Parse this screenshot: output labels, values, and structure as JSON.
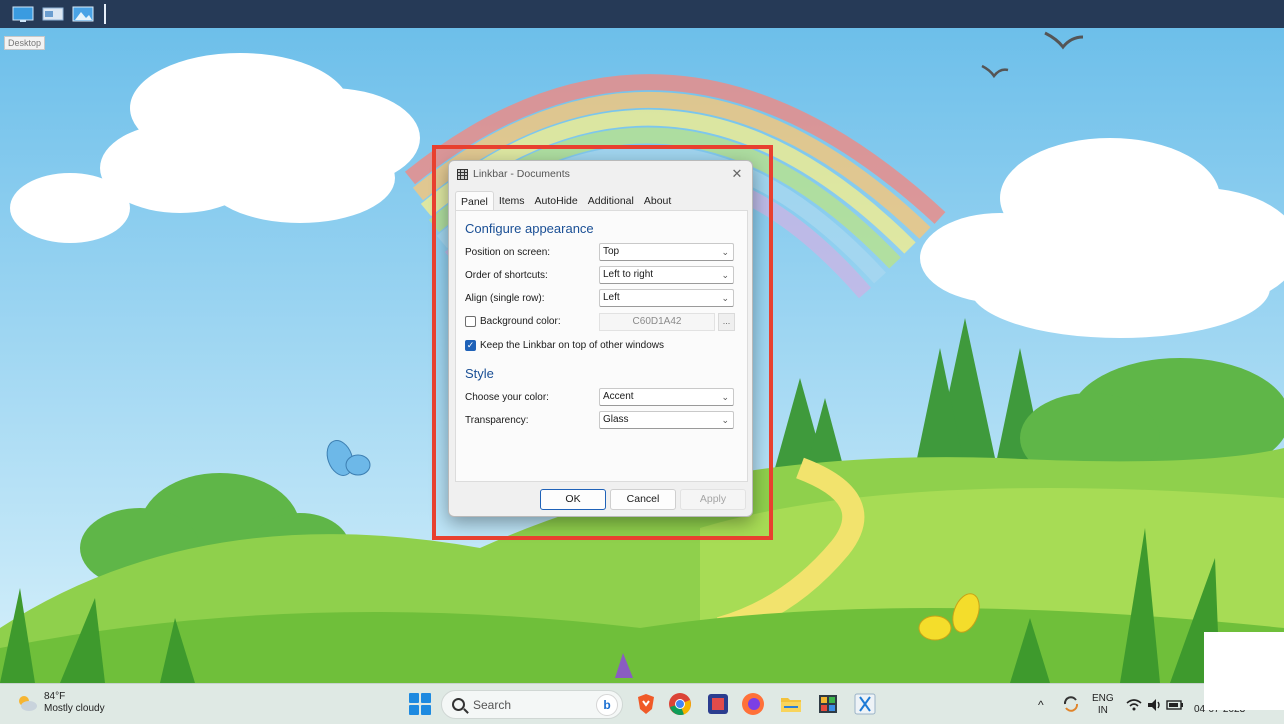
{
  "linkbar": {
    "items": [
      "desktop-icon",
      "explorer-icon",
      "pictures-icon"
    ],
    "tooltip": "Desktop"
  },
  "dialog": {
    "title": "Linkbar - Documents",
    "tabs": [
      "Panel",
      "Items",
      "AutoHide",
      "Additional",
      "About"
    ],
    "active_tab": "Panel",
    "appearance": {
      "heading": "Configure appearance",
      "position_label": "Position on screen:",
      "position_value": "Top",
      "order_label": "Order of shortcuts:",
      "order_value": "Left to right",
      "align_label": "Align (single row):",
      "align_value": "Left",
      "bgcolor_label": "Background color:",
      "bgcolor_checked": false,
      "bgcolor_value": "C60D1A42",
      "bgcolor_button": "...",
      "ontop_label": "Keep the Linkbar on top of other windows",
      "ontop_checked": true
    },
    "style": {
      "heading": "Style",
      "color_label": "Choose your color:",
      "color_value": "Accent",
      "transparency_label": "Transparency:",
      "transparency_value": "Glass"
    },
    "buttons": {
      "ok": "OK",
      "cancel": "Cancel",
      "apply": "Apply"
    },
    "chevron": "⌄",
    "close": "✕",
    "check_mark": "✓"
  },
  "highlight_color": "#e8402f",
  "taskbar": {
    "weather_temp": "84°F",
    "weather_desc": "Mostly cloudy",
    "search_placeholder": "Search",
    "bing_label": "b",
    "apps": [
      "brave-icon",
      "chrome-icon",
      "app-icon",
      "firefox-icon",
      "file-explorer-icon",
      "cube-icon",
      "snipping-icon"
    ],
    "lang_1": "ENG",
    "lang_2": "IN",
    "clock": "04-07-2023",
    "overflow": "^"
  }
}
